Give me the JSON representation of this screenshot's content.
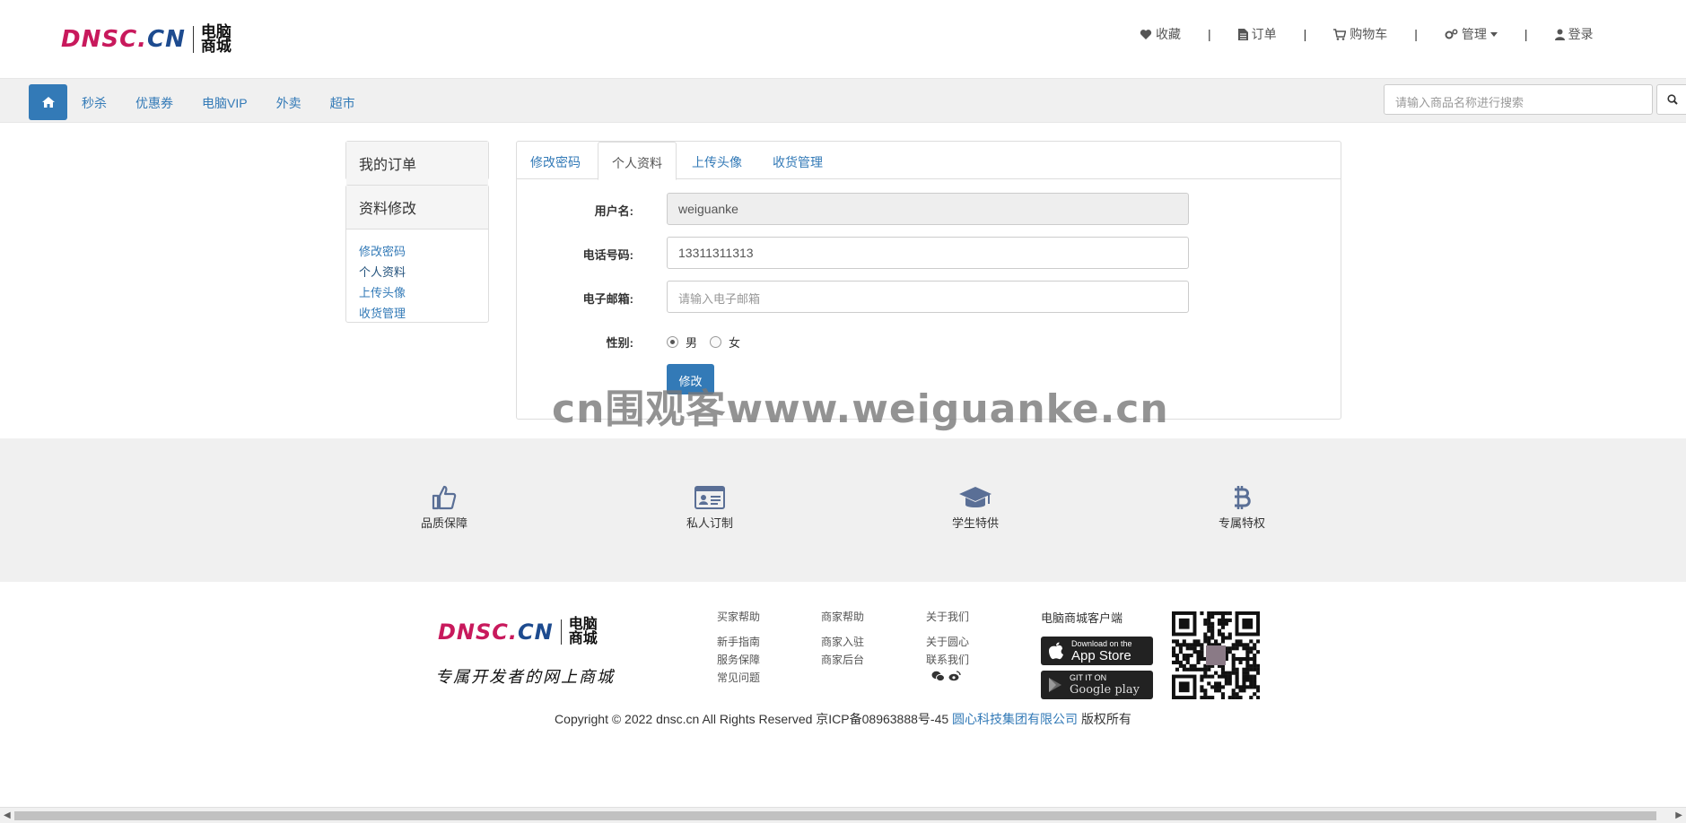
{
  "header": {
    "logo_en": "DNSC.CN",
    "logo_cn_line1": "电脑",
    "logo_cn_line2": "商城",
    "links": {
      "favorites": "收藏",
      "orders": "订单",
      "cart": "购物车",
      "manage": "管理",
      "login": "登录"
    },
    "separator": "|"
  },
  "nav": {
    "items": [
      "秒杀",
      "优惠券",
      "电脑VIP",
      "外卖",
      "超市"
    ],
    "search_placeholder": "请输入商品名称进行搜索"
  },
  "sidebar": {
    "my_orders": "我的订单",
    "profile_edit": "资料修改",
    "links": [
      "修改密码",
      "个人资料",
      "上传头像",
      "收货管理"
    ]
  },
  "tabs": [
    "修改密码",
    "个人资料",
    "上传头像",
    "收货管理"
  ],
  "active_tab": "个人资料",
  "form": {
    "username_label": "用户名:",
    "username_value": "weiguanke",
    "phone_label": "电话号码:",
    "phone_value": "13311311313",
    "email_label": "电子邮箱:",
    "email_placeholder": "请输入电子邮箱",
    "gender_label": "性别:",
    "gender_male": "男",
    "gender_female": "女",
    "gender_selected": "男",
    "submit_label": "修改"
  },
  "watermark": "cn围观客www.weiguanke.cn",
  "features": [
    "品质保障",
    "私人订制",
    "学生特供",
    "专属特权"
  ],
  "footer": {
    "logo_en": "DNSC.CN",
    "logo_cn_line1": "电脑",
    "logo_cn_line2": "商城",
    "slogan": "专属开发者的网上商城",
    "columns": [
      {
        "title": "买家帮助",
        "links": [
          "新手指南",
          "服务保障",
          "常见问题"
        ]
      },
      {
        "title": "商家帮助",
        "links": [
          "商家入驻",
          "商家后台"
        ]
      },
      {
        "title": "关于我们",
        "links": [
          "关于圆心",
          "联系我们"
        ]
      }
    ],
    "app_title": "电脑商城客户端",
    "appstore_small": "Download on the",
    "appstore_big": "App Store",
    "googleplay_small": "GIT IT ON",
    "googleplay_big": "Google play",
    "copyright_text": "Copyright © 2022 dnsc.cn All Rights Reserved 京ICP备08963888号-45",
    "company_link": "圆心科技集团有限公司",
    "copyright_suffix": "版权所有"
  },
  "colors": {
    "primary": "#337ab7",
    "logo_pink": "#c8195c",
    "logo_blue": "#1d4b8f",
    "icon_blue": "#5a6f96"
  }
}
